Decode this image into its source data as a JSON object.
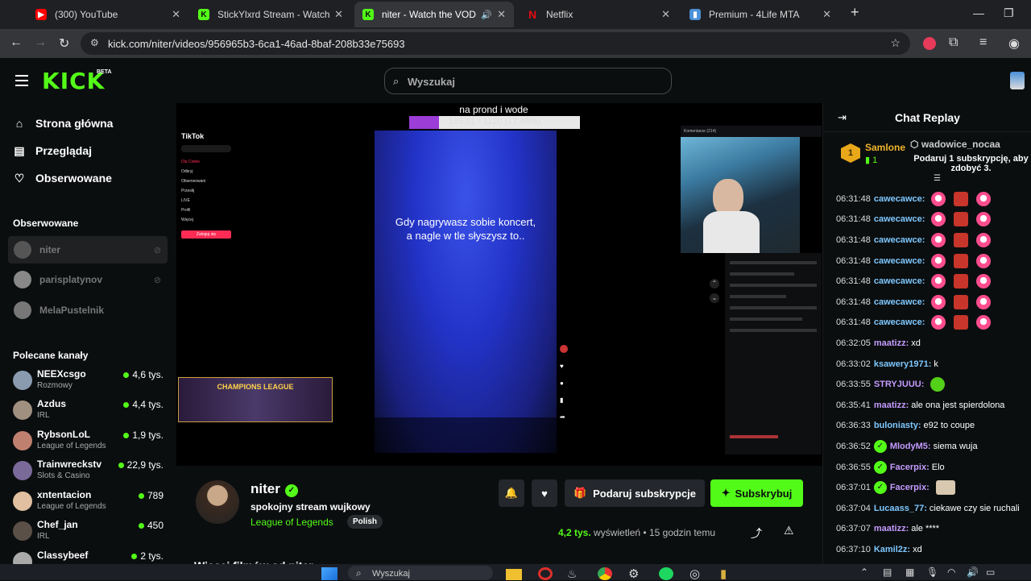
{
  "browser": {
    "tabs": [
      {
        "title": "(300) YouTube",
        "icon": "youtube-icon",
        "color": "#ff0000"
      },
      {
        "title": "StickYlxrd Stream - Watch Live",
        "icon": "kick-icon",
        "color": "#53fc18"
      },
      {
        "title": "niter - Watch the VOD on K",
        "icon": "kick-icon",
        "color": "#53fc18"
      },
      {
        "title": "Netflix",
        "icon": "netflix-icon",
        "color": "#e50914"
      },
      {
        "title": "Premium - 4Life MTA",
        "icon": "puzzle-icon",
        "color": "#4a90d9"
      }
    ],
    "url": "kick.com/niter/videos/956965b3-6ca1-46ad-8baf-208b33e75693"
  },
  "header": {
    "logo": "KICK",
    "beta": "BETA",
    "search_placeholder": "Wyszukaj"
  },
  "sidebar": {
    "nav": [
      {
        "label": "Strona główna",
        "icon": "home-icon"
      },
      {
        "label": "Przeglądaj",
        "icon": "browse-icon"
      },
      {
        "label": "Obserwowane",
        "icon": "heart-icon"
      }
    ],
    "followed_title": "Obserwowane",
    "followed": [
      {
        "name": "niter"
      },
      {
        "name": "parisplatynov"
      },
      {
        "name": "MelaPustelnik"
      }
    ],
    "recommended_title": "Polecane kanały",
    "recommended": [
      {
        "name": "NEEXcsgo",
        "category": "Rozmowy",
        "viewers": "4,6 tys."
      },
      {
        "name": "Azdus",
        "category": "IRL",
        "viewers": "4,4 tys."
      },
      {
        "name": "RybsonLoL",
        "category": "League of Legends",
        "viewers": "1,9 tys."
      },
      {
        "name": "Trainwreckstv",
        "category": "Slots & Casino",
        "viewers": "22,9 tys."
      },
      {
        "name": "xntentacion",
        "category": "League of Legends",
        "viewers": "789"
      },
      {
        "name": "Chef_jan",
        "category": "IRL",
        "viewers": "450"
      },
      {
        "name": "Classybeef",
        "category": "",
        "viewers": "2 tys."
      }
    ]
  },
  "player": {
    "overlay_title": "na prond i wode",
    "progress_label": "195.91 / 1120 (17.49%)",
    "progress_fraction": 0.1749,
    "tiktok": {
      "logo": "TikTok",
      "menu": [
        "Dla Ciebie",
        "Odkryj",
        "Obserwowani",
        "Przesłij",
        "LIVE",
        "Profil",
        "Więcej"
      ],
      "login": "Zaloguj się"
    },
    "caption_line1": "Gdy nagrywasz sobie koncert,",
    "caption_line2": "a nagle w tle słyszysz to..",
    "banner": "CHAMPIONS LEAGUE",
    "comments_header": "Komentarze (214)"
  },
  "video": {
    "channel": "niter",
    "title": "spokojny stream wujkowy",
    "category": "League of Legends",
    "language": "Polish",
    "gift_label": "Podaruj subskrypcje",
    "subscribe_label": "Subskrybuj",
    "views_num": "4,2 tys.",
    "views_label": "wyświetleń",
    "time_ago": "15 godzin temu",
    "more_videos": "Więcej filmów od niter"
  },
  "chat": {
    "title": "Chat Replay",
    "pinned": {
      "rank": "1",
      "top_user": "Samlone",
      "top_count": "1",
      "second_user": "wadowice_nocaa",
      "promo": "Podaruj 1 subskrypcję, aby zdobyć 3."
    },
    "messages": [
      {
        "time": "06:31:48",
        "user": "cawecawce:",
        "color": "#7ec8ff",
        "text": "",
        "emotes": [
          "pink",
          "red",
          "pink"
        ]
      },
      {
        "time": "06:31:48",
        "user": "cawecawce:",
        "color": "#7ec8ff",
        "text": "",
        "emotes": [
          "pink",
          "red",
          "pink"
        ]
      },
      {
        "time": "06:31:48",
        "user": "cawecawce:",
        "color": "#7ec8ff",
        "text": "",
        "emotes": [
          "pink",
          "red",
          "pink"
        ]
      },
      {
        "time": "06:31:48",
        "user": "cawecawce:",
        "color": "#7ec8ff",
        "text": "",
        "emotes": [
          "pink",
          "red",
          "pink"
        ]
      },
      {
        "time": "06:31:48",
        "user": "cawecawce:",
        "color": "#7ec8ff",
        "text": "",
        "emotes": [
          "pink",
          "red",
          "pink"
        ]
      },
      {
        "time": "06:31:48",
        "user": "cawecawce:",
        "color": "#7ec8ff",
        "text": "",
        "emotes": [
          "pink",
          "red",
          "pink"
        ]
      },
      {
        "time": "06:31:48",
        "user": "cawecawce:",
        "color": "#7ec8ff",
        "text": "",
        "emotes": [
          "pink",
          "red",
          "pink"
        ]
      },
      {
        "time": "06:32:05",
        "user": "maatizz:",
        "color": "#c49bff",
        "text": "xd",
        "emotes": []
      },
      {
        "time": "06:33:02",
        "user": "ksawery1971:",
        "color": "#7ec8ff",
        "text": "k",
        "emotes": []
      },
      {
        "time": "06:33:55",
        "user": "STRYJUUU:",
        "color": "#c49bff",
        "text": "",
        "emotes": [
          "green"
        ]
      },
      {
        "time": "06:35:41",
        "user": "maatizz:",
        "color": "#c49bff",
        "text": "ale ona jest spierdolona",
        "emotes": []
      },
      {
        "time": "06:36:33",
        "user": "buloniasty:",
        "color": "#7ec8ff",
        "text": "e92 to coupe",
        "emotes": []
      },
      {
        "time": "06:36:52",
        "user": "MlodyM5:",
        "color": "#c49bff",
        "text": "siema wuja",
        "emotes": []
      },
      {
        "time": "06:36:55",
        "user": "Facerpix:",
        "color": "#c49bff",
        "text": "Elo",
        "emotes": []
      },
      {
        "time": "06:37:01",
        "user": "Facerpix:",
        "color": "#c49bff",
        "text": "",
        "emotes": [
          "cat"
        ]
      },
      {
        "time": "06:37:04",
        "user": "Lucaass_77:",
        "color": "#7ec8ff",
        "text": "ciekawe czy sie ruchali",
        "emotes": []
      },
      {
        "time": "06:37:07",
        "user": "maatizz:",
        "color": "#c49bff",
        "text": "ale ****",
        "emotes": []
      },
      {
        "time": "06:37:10",
        "user": "Kamil2z:",
        "color": "#7ec8ff",
        "text": "xd",
        "emotes": []
      }
    ]
  },
  "taskbar": {
    "search_placeholder": "Wyszukaj"
  }
}
